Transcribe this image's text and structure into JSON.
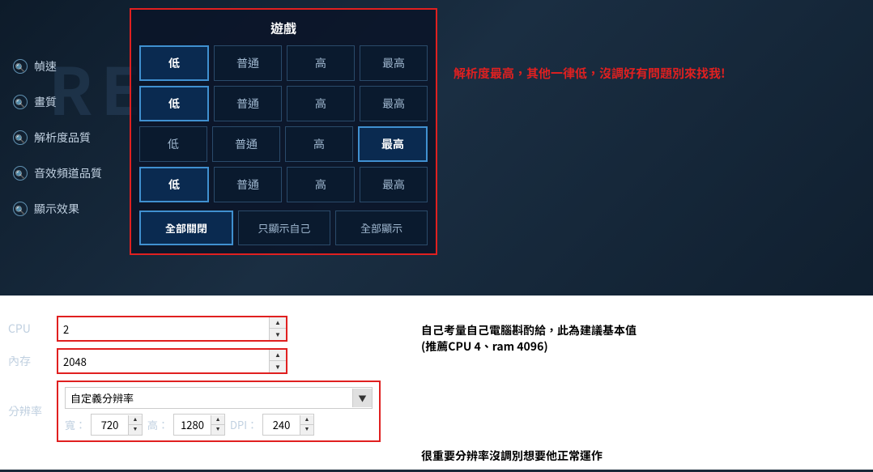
{
  "background": {
    "text": "RE"
  },
  "game_panel": {
    "title": "遊戲",
    "rows": [
      {
        "id": "framerate",
        "buttons": [
          "低",
          "普通",
          "高",
          "最高"
        ],
        "active": 0
      },
      {
        "id": "quality",
        "buttons": [
          "低",
          "普通",
          "高",
          "最高"
        ],
        "active": 0
      },
      {
        "id": "resolution_quality",
        "buttons": [
          "低",
          "普通",
          "高",
          "最高"
        ],
        "active": 3
      },
      {
        "id": "audio_quality",
        "buttons": [
          "低",
          "普通",
          "高",
          "最高"
        ],
        "active": 0
      }
    ],
    "display_row": {
      "buttons": [
        "全部關閉",
        "只顯示自己",
        "全部顯示"
      ],
      "active": 0
    }
  },
  "sidebar": {
    "items": [
      {
        "label": "幀速"
      },
      {
        "label": "畫質"
      },
      {
        "label": "解析度品質"
      },
      {
        "label": "音效頻道品質"
      },
      {
        "label": "顯示效果"
      }
    ]
  },
  "comment_top": "解析度最高，其他一律低，沒調好有問題別來找我!",
  "cpu_field": {
    "label": "CPU",
    "value": "2"
  },
  "memory_field": {
    "label": "內存",
    "value": "2048"
  },
  "resolution_field": {
    "label": "分辨率",
    "select_value": "自定義分辨率",
    "select_options": [
      "自定義分辨率"
    ],
    "width_label": "寬：",
    "width_value": "720",
    "height_label": "高：",
    "height_value": "1280",
    "dpi_label": "DPI：",
    "dpi_value": "240"
  },
  "comment_cpu": "自己考量自己電腦斟酌給，此為建議基本值\n(推薦CPU 4、ram 4096)",
  "comment_res": "很重要分辨率沒調別想要他正常運作"
}
